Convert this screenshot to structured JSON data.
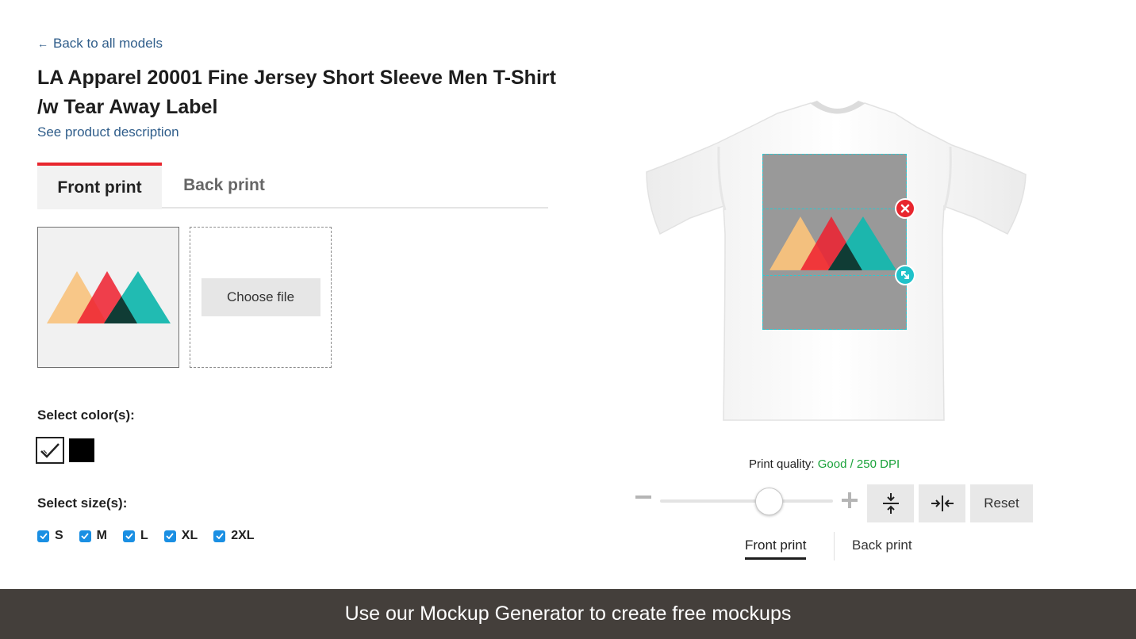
{
  "nav": {
    "back_arrow": "←",
    "back_label": "Back to all models"
  },
  "product": {
    "title": "LA Apparel 20001 Fine Jersey Short Sleeve Men T-Shirt /w Tear Away Label",
    "description_link": "See product description"
  },
  "print_tabs": [
    {
      "label": "Front print",
      "active": true
    },
    {
      "label": "Back print",
      "active": false
    }
  ],
  "upload": {
    "choose_file_label": "Choose file"
  },
  "colors": {
    "label": "Select color(s):",
    "swatches": [
      {
        "name": "white",
        "hex": "#ffffff",
        "selected": true
      },
      {
        "name": "black",
        "hex": "#000000",
        "selected": false
      }
    ]
  },
  "sizes": {
    "label": "Select size(s):",
    "items": [
      {
        "label": "S",
        "checked": true
      },
      {
        "label": "M",
        "checked": true
      },
      {
        "label": "L",
        "checked": true
      },
      {
        "label": "XL",
        "checked": true
      },
      {
        "label": "2XL",
        "checked": true
      }
    ]
  },
  "editor": {
    "print_quality_label": "Print quality:",
    "print_quality_value": "Good / 250 DPI",
    "zoom_level": 0.67,
    "reset_label": "Reset",
    "icons": {
      "remove": "close-icon",
      "resize": "resize-icon",
      "zoom_out": "minus-icon",
      "zoom_in": "plus-icon",
      "center_vertical": "align-vertical-center-icon",
      "center_horizontal": "align-horizontal-center-icon"
    }
  },
  "view_tabs": [
    {
      "label": "Front print",
      "active": true
    },
    {
      "label": "Back print",
      "active": false
    }
  ],
  "footer": {
    "label": "Use our Mockup Generator to create free mockups"
  },
  "accent_colors": {
    "tab_accent": "#e8262e",
    "link": "#2f5d8a",
    "checkbox": "#1a8fe3",
    "guide": "#2ec8d0",
    "quality_good": "#1aa23a",
    "footer_bg": "#443f3b"
  }
}
